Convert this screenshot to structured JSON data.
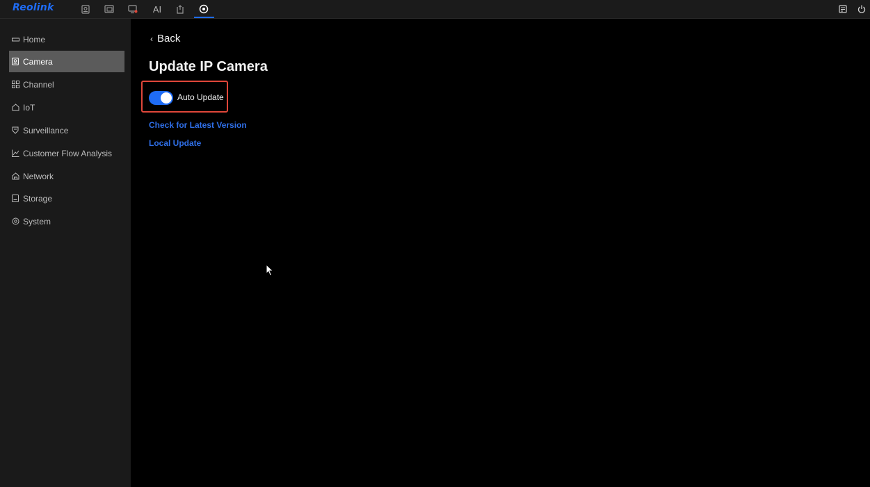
{
  "app": {
    "logo": "Reolink"
  },
  "topnav": {
    "items": [
      {
        "icon": "camera-preview-icon"
      },
      {
        "icon": "playback-icon"
      },
      {
        "icon": "alarm-video-icon"
      },
      {
        "label": "AI"
      },
      {
        "icon": "file-export-icon"
      },
      {
        "icon": "settings-icon",
        "active": true
      }
    ],
    "right": [
      {
        "icon": "message-icon"
      },
      {
        "icon": "power-icon"
      }
    ]
  },
  "sidebar": {
    "items": [
      {
        "label": "Home",
        "icon": "home-icon"
      },
      {
        "label": "Camera",
        "icon": "camera-icon",
        "active": true
      },
      {
        "label": "Channel",
        "icon": "channel-grid-icon"
      },
      {
        "label": "IoT",
        "icon": "iot-house-icon"
      },
      {
        "label": "Surveillance",
        "icon": "shield-icon"
      },
      {
        "label": "Customer Flow Analysis",
        "icon": "chart-line-icon"
      },
      {
        "label": "Network",
        "icon": "network-icon"
      },
      {
        "label": "Storage",
        "icon": "storage-icon"
      },
      {
        "label": "System",
        "icon": "system-gear-icon"
      }
    ]
  },
  "main": {
    "back_label": "Back",
    "title": "Update IP Camera",
    "auto_update": {
      "label": "Auto Update",
      "enabled": true
    },
    "links": {
      "check_latest": "Check for Latest Version",
      "local_update": "Local Update"
    }
  },
  "colors": {
    "accent": "#1f6cf5",
    "highlight": "#e0473a",
    "sidebar_bg": "#1a1a1a",
    "main_bg": "#000000"
  }
}
